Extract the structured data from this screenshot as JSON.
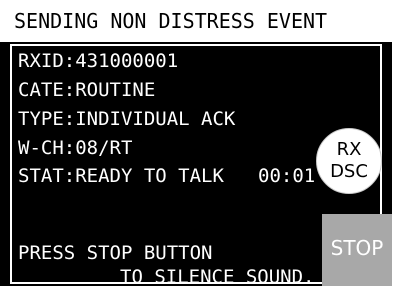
{
  "title": "SENDING NON DISTRESS EVENT",
  "info": {
    "rxid": "RXID:431000001",
    "cate": "CATE:ROUTINE",
    "type": "TYPE:INDIVIDUAL ACK",
    "wch": "W-CH:08/RT",
    "stat": "STAT:READY TO TALK",
    "timer": "00:01"
  },
  "rx_dsc": {
    "line1": "RX",
    "line2": "DSC"
  },
  "message": {
    "line1": "PRESS STOP BUTTON",
    "line2": "TO SILENCE SOUND."
  },
  "stop_label": "STOP"
}
